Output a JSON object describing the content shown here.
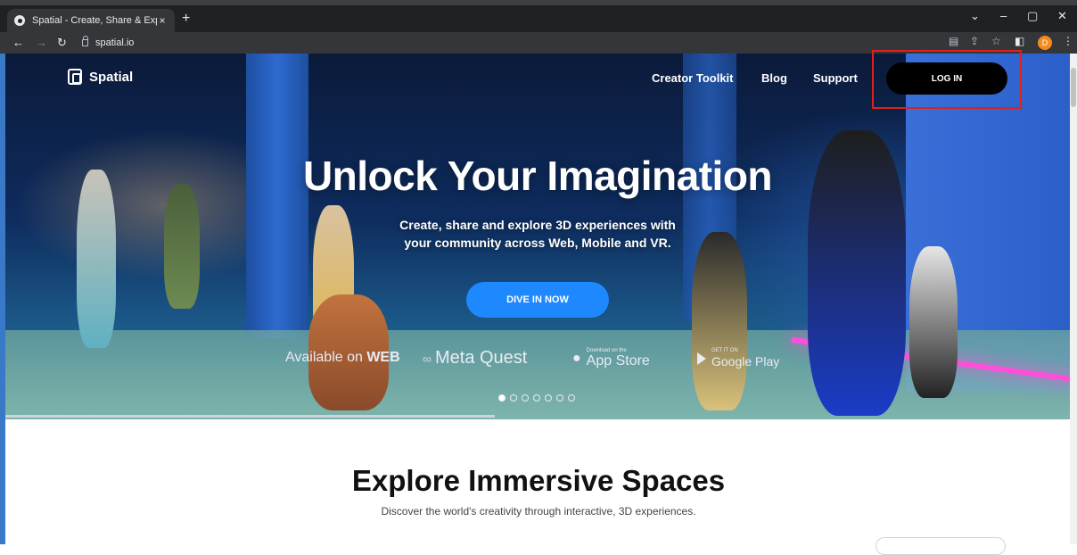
{
  "browser": {
    "tab_title": "Spatial - Create, Share & Experien",
    "tab_close": "×",
    "new_tab": "+",
    "url": "spatial.io",
    "profile_initial": "D",
    "window": {
      "dropdown": "⌄",
      "minimize": "–",
      "restore": "▢",
      "close": "✕"
    },
    "nav": {
      "back": "←",
      "forward": "→",
      "reload": "↻"
    },
    "toolbar": {
      "translate": "▤",
      "share": "⇪",
      "bookmark": "☆",
      "sidepanel": "◧",
      "menu": "⋮"
    }
  },
  "header": {
    "brand": "Spatial",
    "links": [
      "Creator Toolkit",
      "Blog",
      "Support"
    ],
    "login_label": "LOG IN"
  },
  "hero": {
    "headline": "Unlock Your Imagination",
    "subtitle_line1": "Create, share and explore 3D experiences with",
    "subtitle_line2": "your community across Web, Mobile and VR.",
    "cta_label": "DIVE IN NOW",
    "available_prefix": "Available on ",
    "available_web": "WEB",
    "meta_quest": "Meta Quest",
    "app_store_small": "Download on the",
    "app_store": "App Store",
    "google_small": "GET IT ON",
    "google_play": "Google Play",
    "carousel_count": 7,
    "carousel_active": 1,
    "carousel_progress": 0.46
  },
  "explore": {
    "title": "Explore Immersive Spaces",
    "subtitle": "Discover the world's creativity through interactive, 3D experiences."
  },
  "colors": {
    "cta": "#1e88ff",
    "login_bg": "#000000",
    "highlight": "#e0201a",
    "chrome": "#202124"
  }
}
